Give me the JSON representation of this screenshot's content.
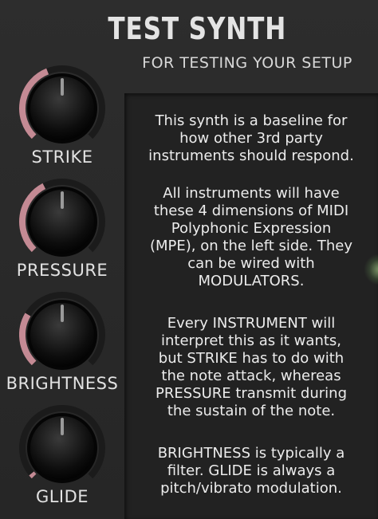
{
  "header": {
    "title": "TEST SYNTH",
    "subtitle": "FOR TESTING YOUR SETUP"
  },
  "knobs": [
    {
      "label": "STRIKE",
      "value": 0.42,
      "accent": "#c48a94"
    },
    {
      "label": "PRESSURE",
      "value": 0.4,
      "accent": "#c48a94"
    },
    {
      "label": "BRIGHTNESS",
      "value": 0.28,
      "accent": "#c48a94"
    },
    {
      "label": "GLIDE",
      "value": 0.02,
      "accent": "#c48a94"
    }
  ],
  "description": {
    "paragraphs": [
      [
        "This synth is a baseline for",
        "how other 3rd party",
        "instruments should respond."
      ],
      [
        "All instruments will have",
        "these 4 dimensions of MIDI",
        "Polyphonic Expression",
        "(MPE), on the left side. They",
        "can be wired with",
        "MODULATORS."
      ],
      [
        "Every INSTRUMENT will",
        "interpret this as it wants,",
        "but STRIKE has to do with",
        "the note attack, whereas",
        "PRESSURE transmit during",
        "the sustain of the note."
      ],
      [
        "BRIGHTNESS is typically a",
        "filter. GLIDE is always a",
        "pitch/vibrato modulation."
      ]
    ]
  },
  "colors": {
    "background": "#2b2b2b",
    "text": "#ececec",
    "arc_track": "#1b1b1b",
    "arc_fill": "#c48a94"
  }
}
